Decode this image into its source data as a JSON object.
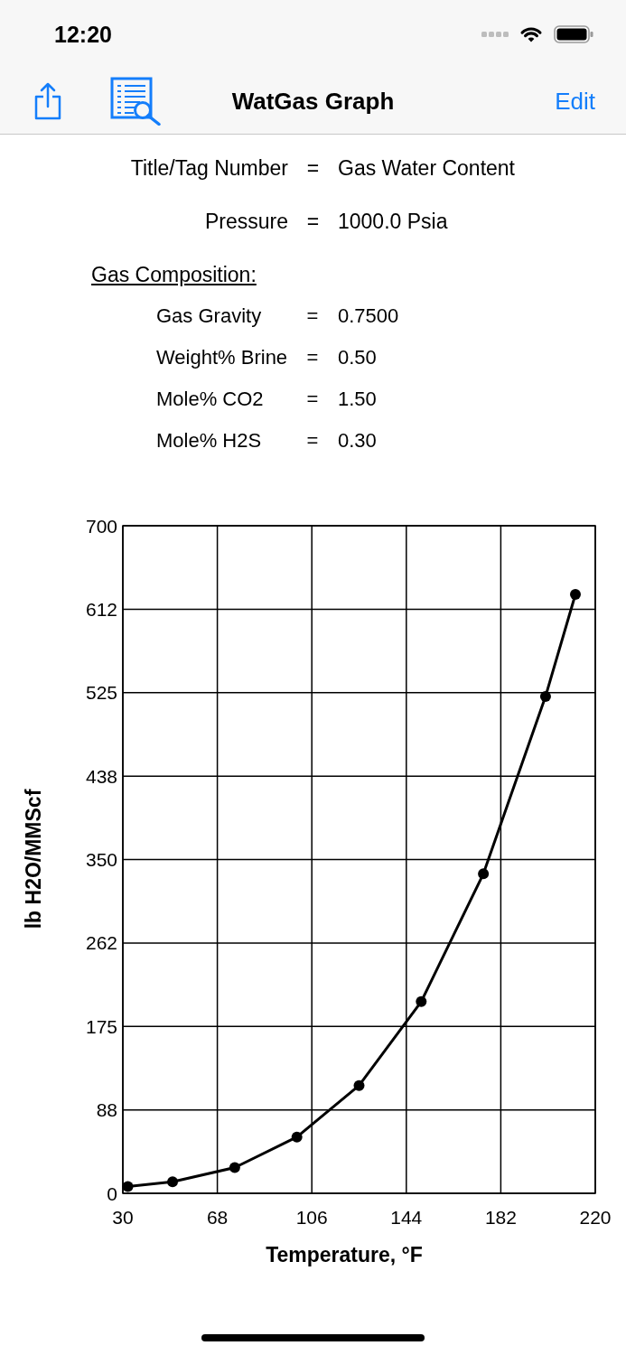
{
  "status_bar": {
    "time": "12:20"
  },
  "nav_bar": {
    "title": "WatGas Graph",
    "edit_button": "Edit"
  },
  "summary": [
    {
      "label": "Title/Tag Number",
      "separator": "=",
      "value": "Gas Water Content"
    },
    {
      "label": "Pressure",
      "separator": "=",
      "value": "1000.0 Psia"
    }
  ],
  "gas_composition": {
    "heading": "Gas Composition:",
    "rows": [
      {
        "label": "Gas Gravity",
        "separator": "=",
        "value": "0.7500"
      },
      {
        "label": "Weight% Brine",
        "separator": "=",
        "value": "0.50"
      },
      {
        "label": "Mole% CO2",
        "separator": "=",
        "value": "1.50"
      },
      {
        "label": "Mole% H2S",
        "separator": "=",
        "value": "0.30"
      }
    ]
  },
  "chart": {
    "chart_data": {
      "type": "line",
      "xlabel": "Temperature, °F",
      "ylabel": "lb H2O/MMScf",
      "x": [
        32,
        50,
        75,
        100,
        125,
        150,
        175,
        200,
        212
      ],
      "values": [
        7,
        12,
        27,
        59,
        113,
        201,
        335,
        521,
        628
      ],
      "xlim": [
        30,
        220
      ],
      "ylim": [
        0,
        700
      ],
      "xticks": [
        30,
        68,
        106,
        144,
        182,
        220
      ],
      "yticks": [
        0,
        {
          "value": 87.5,
          "label": "88"
        },
        175,
        {
          "value": 262.5,
          "label": "262"
        },
        350,
        {
          "value": 437.5,
          "label": "438"
        },
        525,
        {
          "value": 612.5,
          "label": "612"
        },
        700
      ],
      "grid": true,
      "marker": true
    }
  }
}
